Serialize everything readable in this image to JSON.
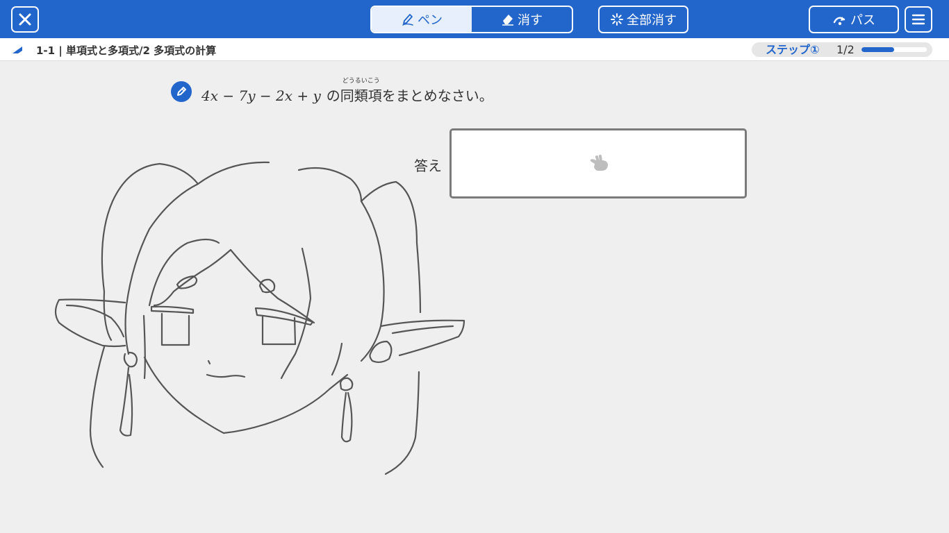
{
  "toolbar": {
    "close_icon": "close-icon",
    "pen_label": "ペン",
    "eraser_label": "消す",
    "clear_all_label": "全部消す",
    "pass_label": "パス",
    "menu_icon": "hamburger-menu-icon",
    "active_tool": "pen",
    "accent_color": "#2266cc"
  },
  "header": {
    "breadcrumb": "1-1 | 単項式と多項式/2 多項式の計算",
    "step_label": "ステップ①",
    "step_count": "1/2",
    "step_progress": 0.5
  },
  "question": {
    "expression": "4x − 7y − 2x + y",
    "particle": "の",
    "term": "同類項",
    "furigana": "どうるいこう",
    "instruction": "をまとめなさい。"
  },
  "answer": {
    "label": "答え",
    "value": ""
  }
}
